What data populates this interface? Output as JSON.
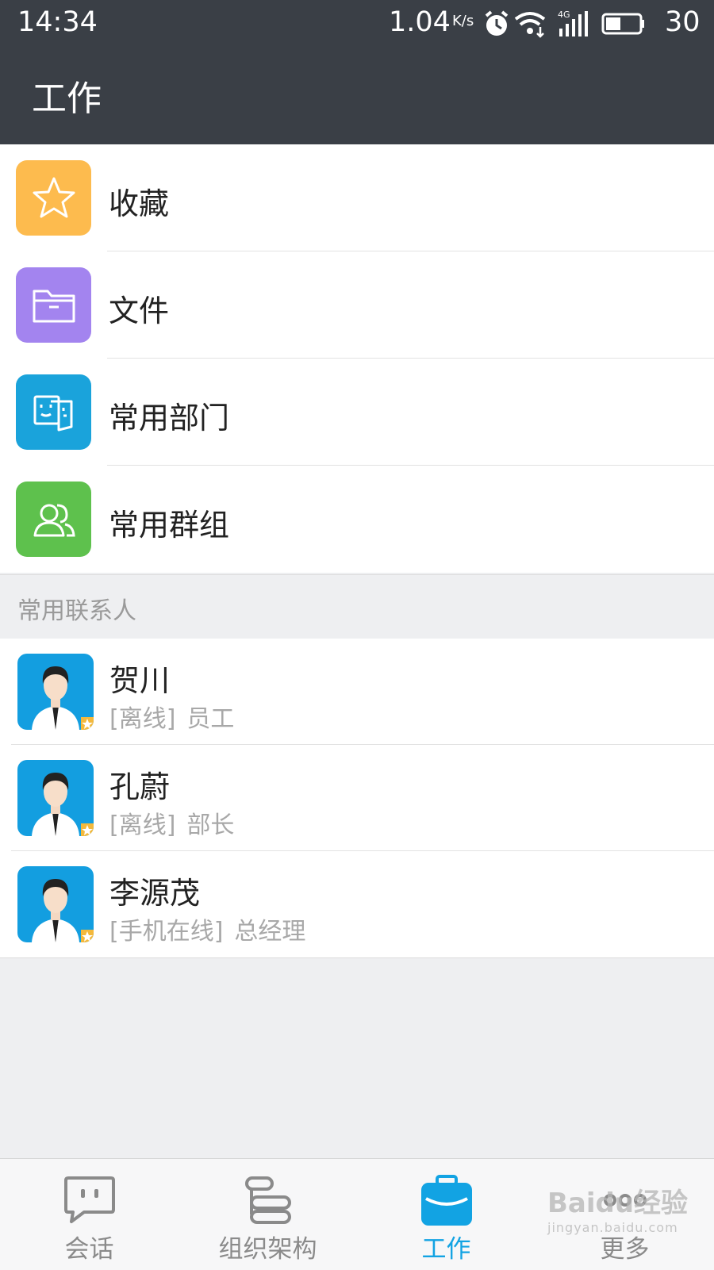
{
  "status_bar": {
    "time": "14:34",
    "speed": "1.04",
    "speed_unit": "K/s",
    "battery": "30"
  },
  "header": {
    "title": "工作"
  },
  "menu_items": [
    {
      "label": "收藏",
      "icon": "star-icon",
      "color": "#fdbb4e"
    },
    {
      "label": "文件",
      "icon": "folder-icon",
      "color": "#a384ef"
    },
    {
      "label": "常用部门",
      "icon": "department-icon",
      "color": "#1aa3db"
    },
    {
      "label": "常用群组",
      "icon": "group-icon",
      "color": "#5ec14d"
    }
  ],
  "section": {
    "title": "常用联系人"
  },
  "contacts": [
    {
      "name": "贺川",
      "status": "[离线]",
      "role": "员工"
    },
    {
      "name": "孔蔚",
      "status": "[离线]",
      "role": "部长"
    },
    {
      "name": "李源茂",
      "status": "[手机在线]",
      "role": "总经理"
    }
  ],
  "tabs": [
    {
      "label": "会话",
      "icon": "chat-icon"
    },
    {
      "label": "组织架构",
      "icon": "org-chart-icon"
    },
    {
      "label": "工作",
      "icon": "briefcase-icon",
      "active": true
    },
    {
      "label": "更多",
      "icon": "more-icon"
    }
  ],
  "watermark": {
    "text": "Baidu经验",
    "sub": "jingyan.baidu.com"
  },
  "colors": {
    "header_bg": "#3a3f46",
    "accent": "#12a3e3"
  }
}
